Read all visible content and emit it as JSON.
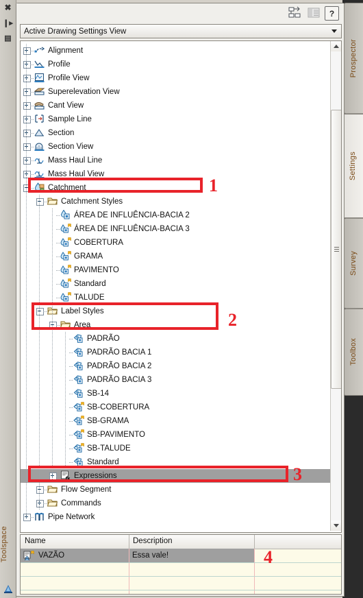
{
  "window": {
    "left_rail": {
      "close_label": "✖",
      "autohide_label": "❙▸",
      "menu_label": "▤",
      "vertical_title": "Toolspace",
      "bottom_icon": "civil3d-icon"
    },
    "right_tabs": [
      {
        "label": "Prospector",
        "active": false
      },
      {
        "label": "Settings",
        "active": true
      },
      {
        "label": "Survey",
        "active": false
      },
      {
        "label": "Toolbox",
        "active": false
      }
    ]
  },
  "toolbar": {
    "buttons": [
      {
        "name": "sync-styles-icon",
        "enabled": true
      },
      {
        "name": "panel-layout-icon",
        "enabled": false
      },
      {
        "name": "help-icon",
        "label": "?",
        "enabled": true
      }
    ]
  },
  "view_selector": {
    "value": "Active Drawing Settings View",
    "placeholder": "Active Drawing Settings View"
  },
  "tree": {
    "nodes": [
      {
        "label": "Alignment",
        "depth": 1,
        "expander": "plus",
        "icon": "alignment-icon",
        "selected": false
      },
      {
        "label": "Profile",
        "depth": 1,
        "expander": "plus",
        "icon": "profile-icon",
        "selected": false
      },
      {
        "label": "Profile View",
        "depth": 1,
        "expander": "plus",
        "icon": "profile-view-icon",
        "selected": false
      },
      {
        "label": "Superelevation View",
        "depth": 1,
        "expander": "plus",
        "icon": "superelevation-icon",
        "selected": false
      },
      {
        "label": "Cant View",
        "depth": 1,
        "expander": "plus",
        "icon": "cant-view-icon",
        "selected": false
      },
      {
        "label": "Sample Line",
        "depth": 1,
        "expander": "plus",
        "icon": "sample-line-icon",
        "selected": false
      },
      {
        "label": "Section",
        "depth": 1,
        "expander": "plus",
        "icon": "section-icon",
        "selected": false
      },
      {
        "label": "Section View",
        "depth": 1,
        "expander": "plus",
        "icon": "section-view-icon",
        "selected": false
      },
      {
        "label": "Mass Haul Line",
        "depth": 1,
        "expander": "plus",
        "icon": "mass-haul-line-icon",
        "selected": false
      },
      {
        "label": "Mass Haul View",
        "depth": 1,
        "expander": "plus",
        "icon": "mass-haul-view-icon",
        "selected": false
      },
      {
        "label": "Catchment",
        "depth": 1,
        "expander": "minus",
        "icon": "catchment-icon",
        "selected": false
      },
      {
        "label": "Catchment Styles",
        "depth": 2,
        "expander": "minus",
        "icon": "folder-icon",
        "selected": false
      },
      {
        "label": "ÁREA DE INFLUÊNCIA-BACIA 2",
        "depth": 3,
        "expander": "none",
        "icon": "catchment-style-icon",
        "selected": false
      },
      {
        "label": "ÁREA DE INFLUÊNCIA-BACIA 3",
        "depth": 3,
        "expander": "none",
        "icon": "catchment-style-flag-icon",
        "selected": false
      },
      {
        "label": "COBERTURA",
        "depth": 3,
        "expander": "none",
        "icon": "catchment-style-flag-icon",
        "selected": false
      },
      {
        "label": "GRAMA",
        "depth": 3,
        "expander": "none",
        "icon": "catchment-style-flag-icon",
        "selected": false
      },
      {
        "label": "PAVIMENTO",
        "depth": 3,
        "expander": "none",
        "icon": "catchment-style-flag-icon",
        "selected": false
      },
      {
        "label": "Standard",
        "depth": 3,
        "expander": "none",
        "icon": "catchment-style-flag-icon",
        "selected": false
      },
      {
        "label": "TALUDE",
        "depth": 3,
        "expander": "none",
        "icon": "catchment-style-flag-icon",
        "selected": false
      },
      {
        "label": "Label Styles",
        "depth": 2,
        "expander": "minus",
        "icon": "folder-icon",
        "selected": false
      },
      {
        "label": "Area",
        "depth": 3,
        "expander": "minus",
        "icon": "folder-icon",
        "selected": false
      },
      {
        "label": "PADRÃO",
        "depth": 4,
        "expander": "none",
        "icon": "label-style-icon",
        "selected": false
      },
      {
        "label": "PADRÃO BACIA 1",
        "depth": 4,
        "expander": "none",
        "icon": "label-style-icon",
        "selected": false
      },
      {
        "label": "PADRÃO BACIA 2",
        "depth": 4,
        "expander": "none",
        "icon": "label-style-icon",
        "selected": false
      },
      {
        "label": "PADRÃO BACIA 3",
        "depth": 4,
        "expander": "none",
        "icon": "label-style-icon",
        "selected": false
      },
      {
        "label": "SB-14",
        "depth": 4,
        "expander": "none",
        "icon": "label-style-icon",
        "selected": false
      },
      {
        "label": "SB-COBERTURA",
        "depth": 4,
        "expander": "none",
        "icon": "label-style-flag-icon",
        "selected": false
      },
      {
        "label": "SB-GRAMA",
        "depth": 4,
        "expander": "none",
        "icon": "label-style-flag-icon",
        "selected": false
      },
      {
        "label": "SB-PAVIMENTO",
        "depth": 4,
        "expander": "none",
        "icon": "label-style-flag-icon",
        "selected": false
      },
      {
        "label": "SB-TALUDE",
        "depth": 4,
        "expander": "none",
        "icon": "label-style-flag-icon",
        "selected": false
      },
      {
        "label": "Standard",
        "depth": 4,
        "expander": "none",
        "icon": "label-style-icon",
        "selected": false
      },
      {
        "label": "Expressions",
        "depth": 3,
        "expander": "plus",
        "icon": "expressions-icon",
        "selected": true
      },
      {
        "label": "Flow Segment",
        "depth": 2,
        "expander": "minus",
        "icon": "folder-icon",
        "selected": false
      },
      {
        "label": "Commands",
        "depth": 2,
        "expander": "plus",
        "icon": "folder-icon",
        "selected": false
      },
      {
        "label": "Pipe Network",
        "depth": 1,
        "expander": "plus",
        "icon": "pipe-network-icon",
        "selected": false
      }
    ]
  },
  "scrollbar": {
    "up_arrow": "▲",
    "down_arrow": "▼"
  },
  "item_grid": {
    "columns": [
      "Name",
      "Description",
      ""
    ],
    "rows": [
      {
        "name": "VAZÃO",
        "description": "Essa vale!",
        "extra": "",
        "icon": "expression-item-icon",
        "selected": true
      },
      {
        "name": "",
        "description": "",
        "extra": "",
        "icon": "",
        "selected": false
      },
      {
        "name": "",
        "description": "",
        "extra": "",
        "icon": "",
        "selected": false
      }
    ]
  },
  "annotations": [
    {
      "number": "1",
      "target": "catchment-row"
    },
    {
      "number": "2",
      "target": "label-styles-area-rows"
    },
    {
      "number": "3",
      "target": "expressions-row"
    },
    {
      "number": "4",
      "target": "grid-extra-column"
    }
  ],
  "colors": {
    "annotation_red": "#e8232a",
    "selection_gray": "#9f9f9f",
    "tab_text": "#7a4a16",
    "grid_background": "#fdfbe8"
  }
}
